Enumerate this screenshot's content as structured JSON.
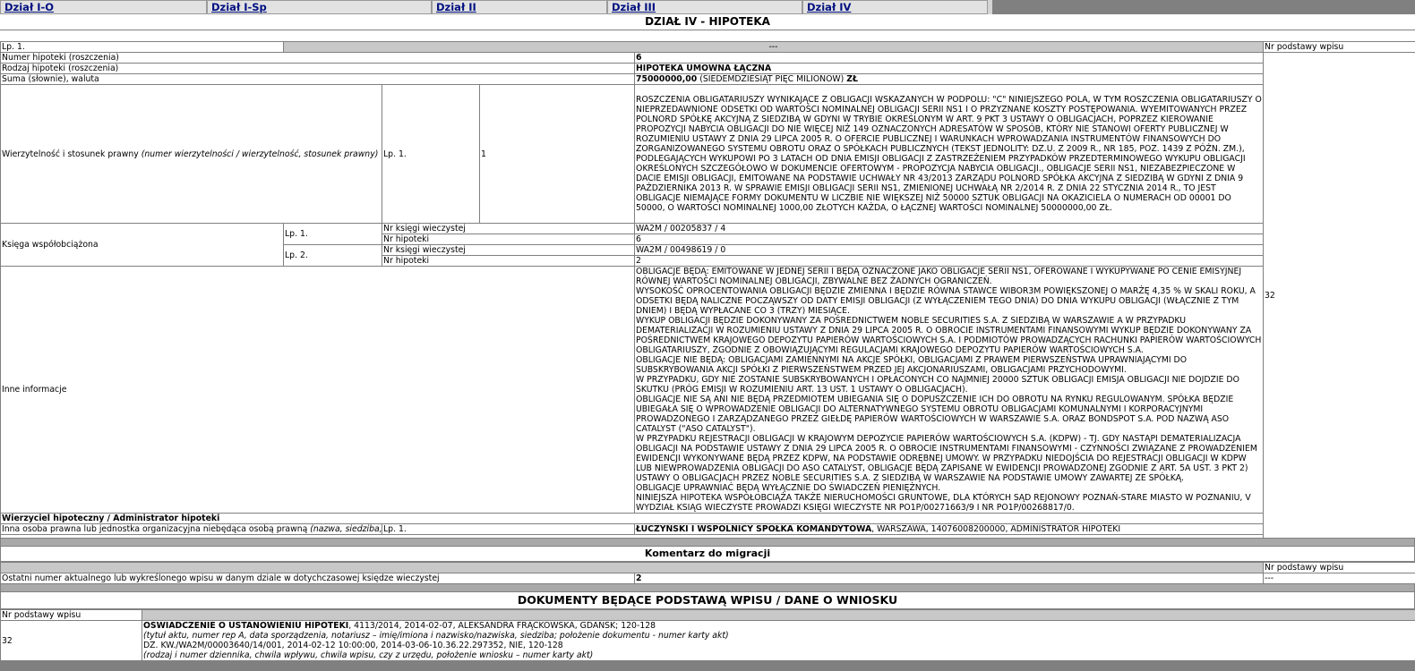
{
  "tabs": [
    "Dział I-O",
    "Dział I-Sp",
    "Dział II",
    "Dział III",
    "Dział IV"
  ],
  "section_title": "DZIAŁ IV - HIPOTEKA",
  "entry": {
    "lp": "Lp. 1.",
    "dashes": "---",
    "basis_header": "Nr podstawy wpisu",
    "basis_value": "32",
    "rows": {
      "number_label": "Numer hipoteki (roszczenia)",
      "number_value": "6",
      "type_label": "Rodzaj hipoteki (roszczenia)",
      "type_value": "HIPOTEKA UMOWNA ŁĄCZNA",
      "sum_label": "Suma (słownie), waluta",
      "sum_amount": "75000000,00",
      "sum_words": "(SIEDEMDZIESIĄT PIĘĆ MILIONÓW)",
      "sum_currency": "ZŁ",
      "claim_label": "Wierzytelność i stosunek prawny",
      "claim_label_italic": "(numer wierzytelności / wierzytelność, stosunek prawny)",
      "claim_lp": "Lp. 1.",
      "claim_number": "1",
      "claim_text": "ROSZCZENIA OBLIGATARIUSZY WYNIKAJĄCE Z OBLIGACJI WSKAZANYCH W PODPOLU: \"C\" NINIEJSZEGO POLA, W TYM ROSZCZENIA OBLIGATARIUSZY O NIEPRZEDAWNIONE ODSETKI OD WARTOŚCI NOMINALNEJ OBLIGACJI SERII NS1 I O PRZYZNANE KOSZTY POSTĘPOWANIA. WYEMITOWANYCH PRZEZ POLNORD SPÓŁKĘ AKCYJNĄ Z SIEDZIBĄ W GDYNI W TRYBIE OKREŚLONYM W ART. 9 PKT 3 USTAWY O OBLIGACJACH, POPRZEZ KIEROWANIE PROPOZYCJI NABYCIA OBLIGACJI DO NIE WIĘCEJ NIŻ 149 OZNACZONYCH ADRESATÓW W SPOSÓB, KTÓRY NIE STANOWI OFERTY PUBLICZNEJ W ROZUMIENIU USTAWY Z DNIA 29 LIPCA 2005 R. O OFERCIE PUBLICZNEJ I WARUNKACH WPROWADZANIA INSTRUMENTÓW FINANSOWYCH DO ZORGANIZOWANEGO SYSTEMU OBROTU ORAZ O SPÓŁKACH PUBLICZNYCH (TEKST JEDNOLITY: DZ.U. Z 2009 R., NR 185, POZ. 1439 Z PÓŹN. ZM.), PODLEGAJĄCYCH WYKUPOWI PO 3 LATACH OD DNIA EMISJI OBLIGACJI Z ZASTRZEŻENIEM PRZYPADKÓW PRZEDTERMINOWEGO WYKUPU OBLIGACJI OKREŚLONYCH SZCZEGÓŁOWO W DOKUMENCIE OFERTOWYM - PROPOZYCJA NABYCIA OBLIGACJI., OBLIGACJE SERII NS1, NIEZABEZPIECZONE W DACIE EMISJI OBLIGACJI, EMITOWANE NA PODSTAWIE UCHWAŁY NR 43/2013 ZARZĄDU POLNORD SPÓŁKA AKCYJNA Z SIEDZIBĄ W GDYNI Z DNIA 9 PAŹDZIERNIKA 2013 R. W SPRAWIE EMISJI OBLIGACJI SERII NS1, ZMIENIONEJ UCHWAŁĄ NR 2/2014 R. Z DNIA 22 STYCZNIA 2014 R., TO JEST OBLIGACJE NIEMAJĄCE FORMY DOKUMENTU W LICZBIE NIE WIĘKSZEJ NIŻ 50000 SZTUK OBLIGACJI NA OKAZICIELA O NUMERACH OD 00001 DO 50000, O WARTOŚCI NOMINALNEJ 1000,00 ZŁOTYCH KAŻDA, O ŁĄCZNEJ WARTOŚCI NOMINALNEJ 50000000,00 ZŁ.",
      "book_label": "Księga współobciążona",
      "book1_lp": "Lp. 1.",
      "book2_lp": "Lp. 2.",
      "kw_label": "Nr księgi wieczystej",
      "hip_label": "Nr hipoteki",
      "book1_kw": "WA2M / 00205837 / 4",
      "book1_hip": "6",
      "book2_kw": "WA2M / 00498619 / 0",
      "book2_hip": "2",
      "other_label": "Inne informacje",
      "other_text": [
        "OBLIGACJE BĘDĄ: EMITOWANE W JEDNEJ SERII I BĘDĄ OZNACZONE JAKO OBLIGACJE SERII NS1, OFEROWANE I WYKUPYWANE PO CENIE EMISYJNEJ RÓWNEJ WARTOŚCI NOMINALNEJ OBLIGACJI, ZBYWALNE BEZ ŻADNYCH OGRANICZEŃ.",
        "WYSOKOŚĆ OPROCENTOWANIA OBLIGACJI BĘDZIE ZMIENNA I BĘDZIE RÓWNA STAWCE WIBOR3M POWIĘKSZONEJ O MARŻĘ 4,35 % W SKALI ROKU, A ODSETKI BĘDĄ NALICZNE POCZĄWSZY OD DATY EMISJI OBLIGACJI (Z WYŁĄCZENIEM TEGO DNIA) DO DNIA WYKUPU OBLIGACJI (WŁĄCZNIE Z TYM DNIEM) I BĘDĄ WYPŁACANE CO 3 (TRZY) MIESIĄCE.",
        "WYKUP OBLIGACJI BĘDZIE DOKONYWANY ZA POŚREDNICTWEM NOBLE SECURITIES S.A. Z SIEDZIBĄ W WARSZAWIE A W PRZYPADKU DEMATERIALIZACJI W ROZUMIENIU USTAWY Z DNIA 29 LIPCA 2005 R. O OBROCIE INSTRUMENTAMI FINANSOWYMI WYKUP BĘDZIE DOKONYWANY ZA POŚREDNICTWEM KRAJOWEGO DEPOZYTU PAPIERÓW WARTOŚCIOWYCH S.A. I PODMIOTÓW PROWADZĄCYCH RACHUNKI PAPIERÓW WARTOŚCIOWYCH OBLIGATARIUSZY, ZGODNIE Z OBOWIĄZUJĄCYMI REGULACJAMI KRAJOWEGO DEPOZYTU PAPIERÓW WARTOŚCIOWYCH S.A.",
        "OBLIGACJE NIE BĘDĄ: OBLIGACJAMI ZAMIENNYMI NA AKCJE SPÓŁKI, OBLIGACJAMI Z PRAWEM PIERWSZEŃSTWA UPRAWNIAJĄCYMI DO SUBSKRYBOWANIA AKCJI SPÓŁKI Z PIERWSZEŃSTWEM PRZED JEJ AKCJONARIUSZAMI, OBLIGACJAMI PRZYCHODOWYMI.",
        "W PRZYPADKU, GDY NIE ZOSTANIE SUBSKRYBOWANYCH I OPŁACONYCH CO NAJMNIEJ 20000 SZTUK OBLIGACJI EMISJA OBLIGACJI NIE DOJDZIE DO SKUTKU (PRÓG EMISJI W ROZUMIENIU ART. 13 UST. 1 USTAWY O OBLIGACJACH).",
        "OBLIGACJE NIE SĄ ANI NIE BĘDĄ PRZEDMIOTEM UBIEGANIA SIĘ O DOPUSZCZENIE ICH DO OBROTU NA RYNKU REGULOWANYM. SPÓŁKA BĘDZIE UBIEGAŁA SIĘ O WPROWADZENIE OBLIGACJI DO ALTERNATYWNEGO SYSTEMU OBROTU OBLIGACJAMI KOMUNALNYMI I KORPORACYJNYMI PROWADZONEGO I ZARZĄDZANEGO PRZEZ GIEŁDĘ PAPIERÓW WARTOŚCIOWYCH W WARSZAWIE S.A. ORAZ BONDSPOT S.A. POD NAZWĄ ASO CATALYST (\"ASO CATALYST\").",
        "W PRZYPADKU REJESTRACJI OBLIGACJI W KRAJOWYM DEPOZYCIE PAPIERÓW WARTOŚCIOWYCH S.A. (KDPW) - TJ. GDY NASTĄPI DEMATERIALIZACJA OBLIGACJI NA PODSTAWIE USTAWY Z DNIA 29 LIPCA 2005 R. O OBROCIE INSTRUMENTAMI FINANSOWYMI - CZYNNOŚCI ZWIĄZANE Z PROWADZENIEM EWIDENCJI WYKONYWANE BĘDĄ PRZEZ KDPW, NA PODSTAWIE ODRĘBNEJ UMOWY. W PRZYPADKU NIEDOJŚCIA DO REJESTRACJI OBLIGACJI W KDPW LUB NIEWPROWADZENIA OBLIGACJI DO ASO CATALYST, OBLIGACJE BĘDĄ ZAPISANE W EWIDENCJI PROWADZONEJ ZGODNIE Z ART. 5A UST. 3 PKT 2) USTAWY O OBLIGACJACH PRZEZ NOBLE SECURITIES S.A. Z SIEDZIBĄ W WARSZAWIE NA PODSTAWIE UMOWY ZAWARTEJ ZE SPÓŁKĄ.",
        "OBLIGACJE UPRAWNIAĆ BĘDĄ WYŁĄCZNIE DO ŚWIADCZEŃ PIENIĘŻNYCH.",
        "NINIEJSZA HIPOTEKA WSPÓŁOBCIĄŻA TAKŻE NIERUCHOMOŚCI GRUNTOWE, DLA KTÓRYCH SĄD REJONOWY POZNAŃ-STARE MIASTO W POZNANIU, V WYDZIAŁ KSIĄG WIECZYSTE PROWADZI KSIĘGI WIECZYSTE NR PO1P/00271663/9 I NR PO1P/00268817/0."
      ],
      "creditor_header": "Wierzyciel hipoteczny / Administrator hipoteki",
      "person_label": "Inna osoba prawna lub jednostka organizacyjna niebędąca osobą prawną",
      "person_label_italic": "(nazwa, siedziba, REGON, administrator hipoteki)",
      "person_lp": "Lp. 1.",
      "person_name": "ŁUCZYŃSKI I WSPÓLNICY SPÓŁKA KOMANDYTOWA",
      "person_rest": ", WARSZAWA, 14076008200000, ADMINISTRATOR HIPOTEKI"
    }
  },
  "migration": {
    "title": "Komentarz do migracji",
    "basis_header": "Nr podstawy wpisu",
    "last_label": "Ostatni numer aktualnego lub wykreślonego wpisu w danym dziale w dotychczasowej księdze wieczystej",
    "last_value": "2",
    "last_basis": "---"
  },
  "documents": {
    "title": "DOKUMENTY BĘDĄCE PODSTAWĄ WPISU / DANE O WNIOSKU",
    "basis_header": "Nr podstawy wpisu",
    "basis_value": "32",
    "doc_title": "OŚWIADCZENIE O USTANOWIENIU HIPOTEKI",
    "doc_rest": ", 4113/2014, 2014-02-07, ALEKSANDRA FRĄCKOWSKA, GDAŃSK; 120-128",
    "doc_hint": "(tytuł aktu, numer rep A, data sporządzenia, notariusz – imię/imiona i nazwisko/nazwiska, siedziba; położenie dokumentu - numer karty akt)",
    "wniosek": "DZ. KW./WA2M/00003640/14/001, 2014-02-12 10:00:00, 2014-03-06-10.36.22.297352, NIE, 120-128",
    "wniosek_hint": "(rodzaj i numer dziennika, chwila wpływu, chwila wpisu, czy z urzędu, położenie wniosku – numer karty akt)"
  }
}
